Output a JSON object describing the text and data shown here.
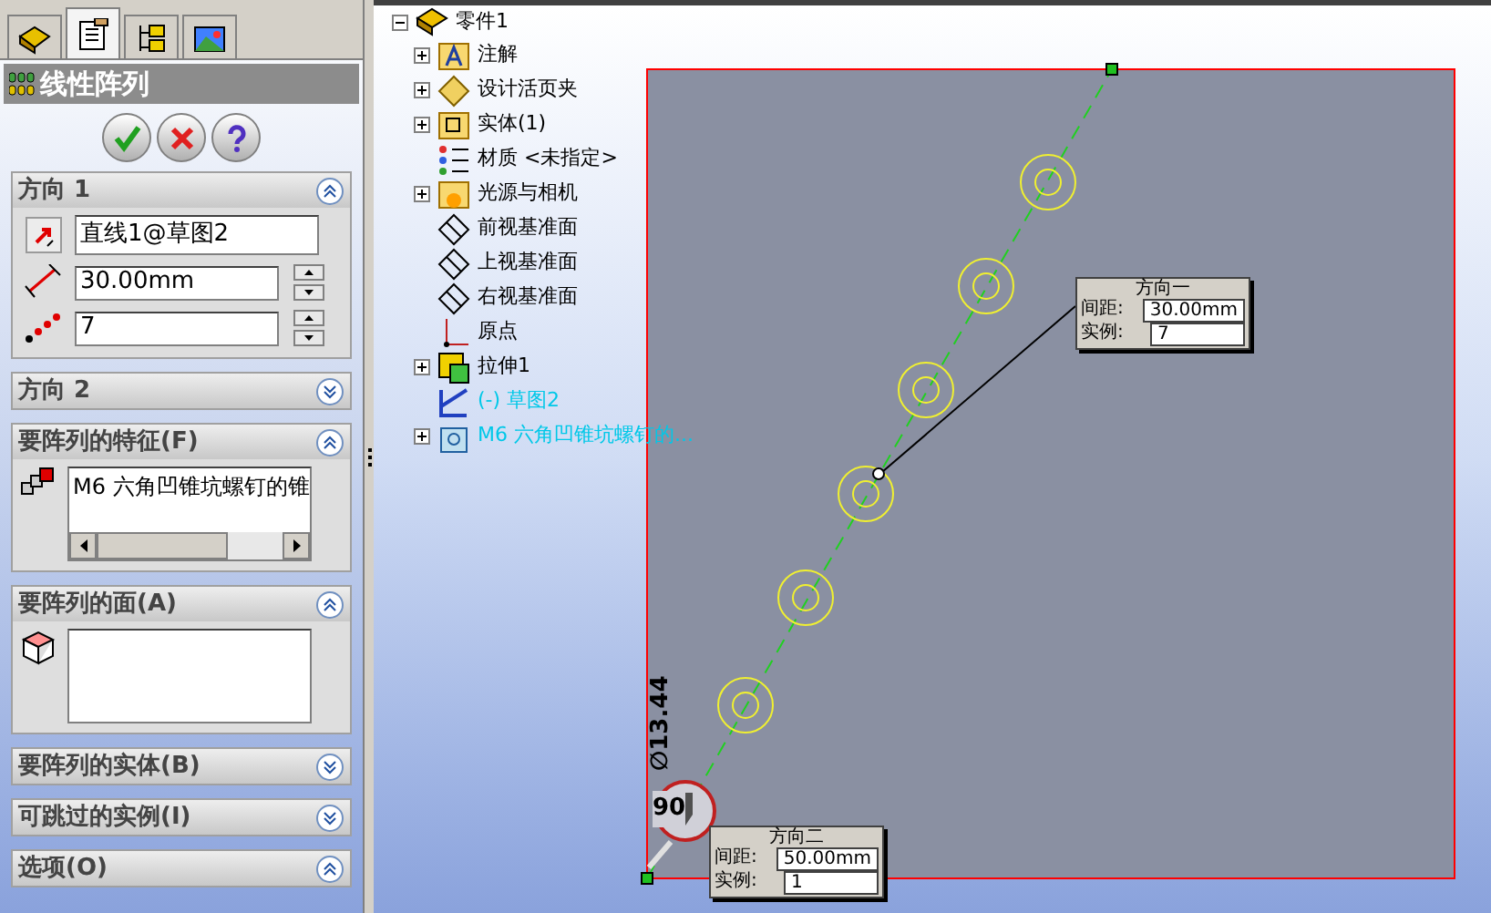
{
  "panel": {
    "tabs": [
      {
        "selected": false
      },
      {
        "selected": true
      },
      {
        "selected": false
      },
      {
        "selected": false
      }
    ],
    "title": "线性阵列",
    "groups": [
      {
        "title": "方向 1",
        "kind": "direction",
        "expanded": true,
        "fields": [
          {
            "kind": "reference",
            "value": "直线1@草图2"
          },
          {
            "kind": "spacing",
            "value": "30.00mm"
          },
          {
            "kind": "count",
            "value": "7"
          }
        ]
      },
      {
        "title": "方向 2",
        "expanded": false
      },
      {
        "title": "要阵列的特征(F)",
        "kind": "features",
        "expanded": true,
        "items": [
          "M6 六角凹锥坑螺钉的锥"
        ]
      },
      {
        "title": "要阵列的面(A)",
        "kind": "faces",
        "expanded": true
      },
      {
        "title": "要阵列的实体(B)",
        "expanded": false
      },
      {
        "title": "可跳过的实例(I)",
        "expanded": false
      },
      {
        "title": "选项(O)",
        "expanded": true
      }
    ]
  },
  "tree": {
    "label": "零件1",
    "kind": "part",
    "expanded": true,
    "children": [
      {
        "label": "注解",
        "kind": "annotation",
        "expanded": false,
        "color": "#000000"
      },
      {
        "label": "设计活页夹",
        "kind": "binder",
        "expanded": false,
        "color": "#000000"
      },
      {
        "label": "实体(1)",
        "kind": "bodies",
        "expanded": false,
        "color": "#000000"
      },
      {
        "label": "材质 <未指定>",
        "kind": "material",
        "color": "#000000"
      },
      {
        "label": "光源与相机",
        "kind": "lights",
        "expanded": false,
        "color": "#000000"
      },
      {
        "label": "前视基准面",
        "kind": "plane",
        "color": "#000000"
      },
      {
        "label": "上视基准面",
        "kind": "plane",
        "color": "#000000"
      },
      {
        "label": "右视基准面",
        "kind": "plane",
        "color": "#000000"
      },
      {
        "label": "原点",
        "kind": "origin",
        "color": "#000000"
      },
      {
        "label": "拉伸1",
        "kind": "extrude",
        "expanded": false,
        "color": "#000000"
      },
      {
        "label": "(-) 草图2",
        "kind": "sketch",
        "color": "#00c8e8"
      },
      {
        "label": "M6 六角凹锥坑螺钉的...",
        "kind": "hole",
        "expanded": false,
        "color": "#00c8e8"
      }
    ]
  },
  "canvas": {
    "diameter": "∅13.44",
    "angle": "90",
    "callouts": [
      {
        "title": "方向一",
        "rows": [
          {
            "label": "间距:",
            "value": "30.00mm"
          },
          {
            "label": "实例:",
            "value": "7"
          }
        ]
      },
      {
        "title": "方向二",
        "rows": [
          {
            "label": "间距:",
            "value": "50.00mm"
          },
          {
            "label": "实例:",
            "value": "1"
          }
        ]
      }
    ]
  }
}
